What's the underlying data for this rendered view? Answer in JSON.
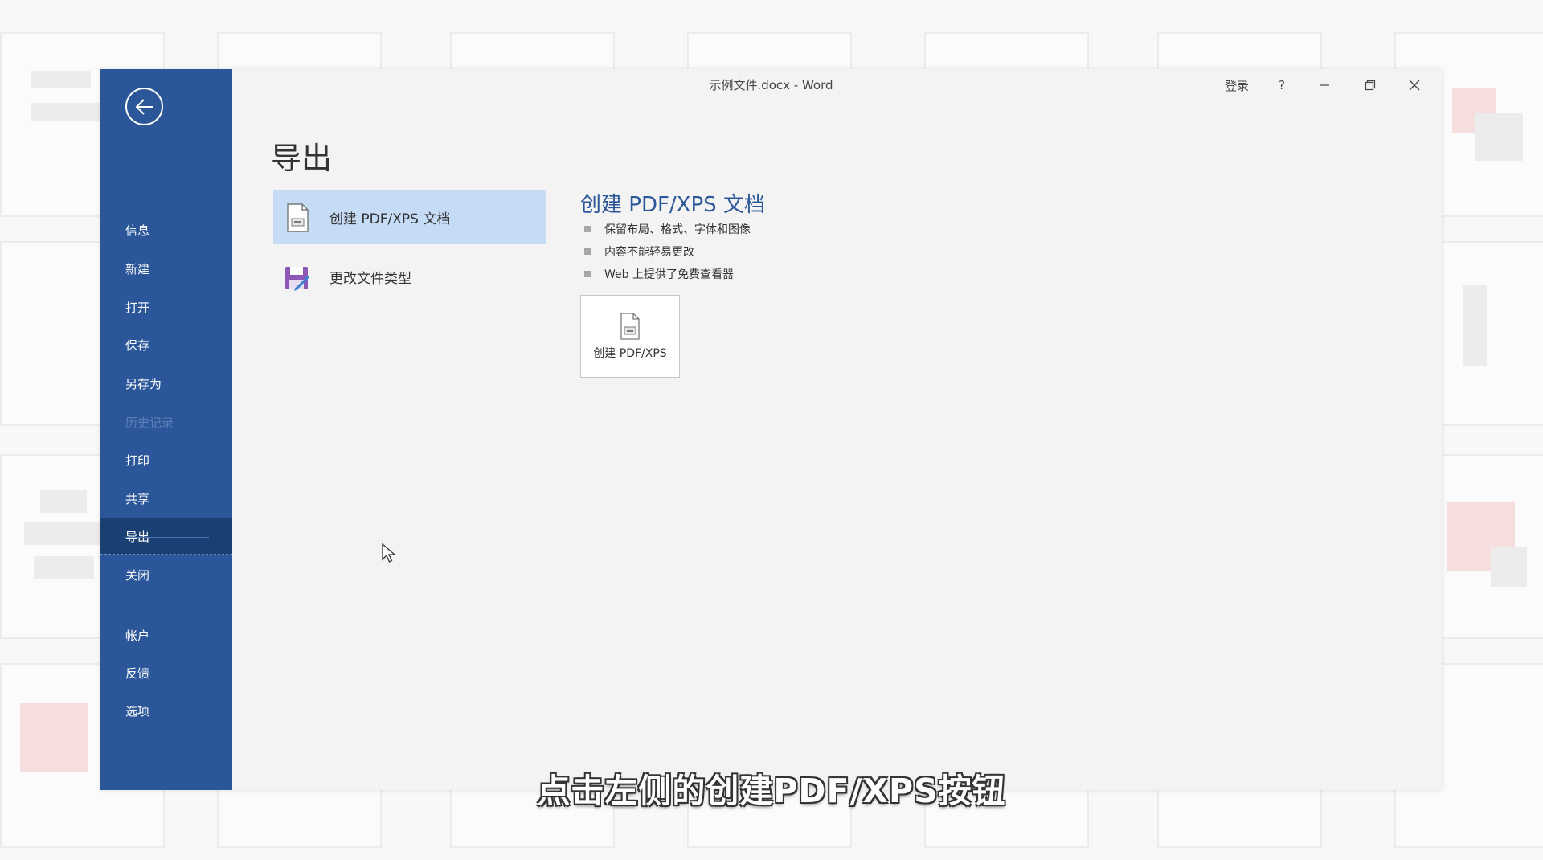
{
  "window": {
    "title": "示例文件.docx  -  Word",
    "signin_label": "登录",
    "help_label": "?"
  },
  "sidebar": {
    "items": [
      {
        "label": "信息",
        "state": "normal"
      },
      {
        "label": "新建",
        "state": "normal"
      },
      {
        "label": "打开",
        "state": "normal"
      },
      {
        "label": "保存",
        "state": "normal"
      },
      {
        "label": "另存为",
        "state": "normal"
      },
      {
        "label": "历史记录",
        "state": "disabled"
      },
      {
        "label": "打印",
        "state": "normal"
      },
      {
        "label": "共享",
        "state": "normal"
      },
      {
        "label": "导出",
        "state": "active"
      },
      {
        "label": "关闭",
        "state": "normal"
      }
    ],
    "bottom_items": [
      {
        "label": "帐户"
      },
      {
        "label": "反馈"
      },
      {
        "label": "选项"
      }
    ]
  },
  "main": {
    "page_title": "导出",
    "options": [
      {
        "label": "创建 PDF/XPS 文档",
        "selected": true,
        "icon": "pdf-document-icon"
      },
      {
        "label": "更改文件类型",
        "selected": false,
        "icon": "change-file-type-icon"
      }
    ],
    "detail": {
      "title": "创建 PDF/XPS 文档",
      "bullets": [
        "保留布局、格式、字体和图像",
        "内容不能轻易更改",
        "Web 上提供了免费查看器"
      ],
      "button_label": "创建 PDF/XPS"
    }
  },
  "subtitle": "点击左侧的创建PDF/XPS按钮",
  "colors": {
    "sidebar": "#2b579a",
    "sidebar_active": "#1a3f73",
    "selected_option": "#c5dbf6",
    "accent_text": "#2b579a"
  }
}
